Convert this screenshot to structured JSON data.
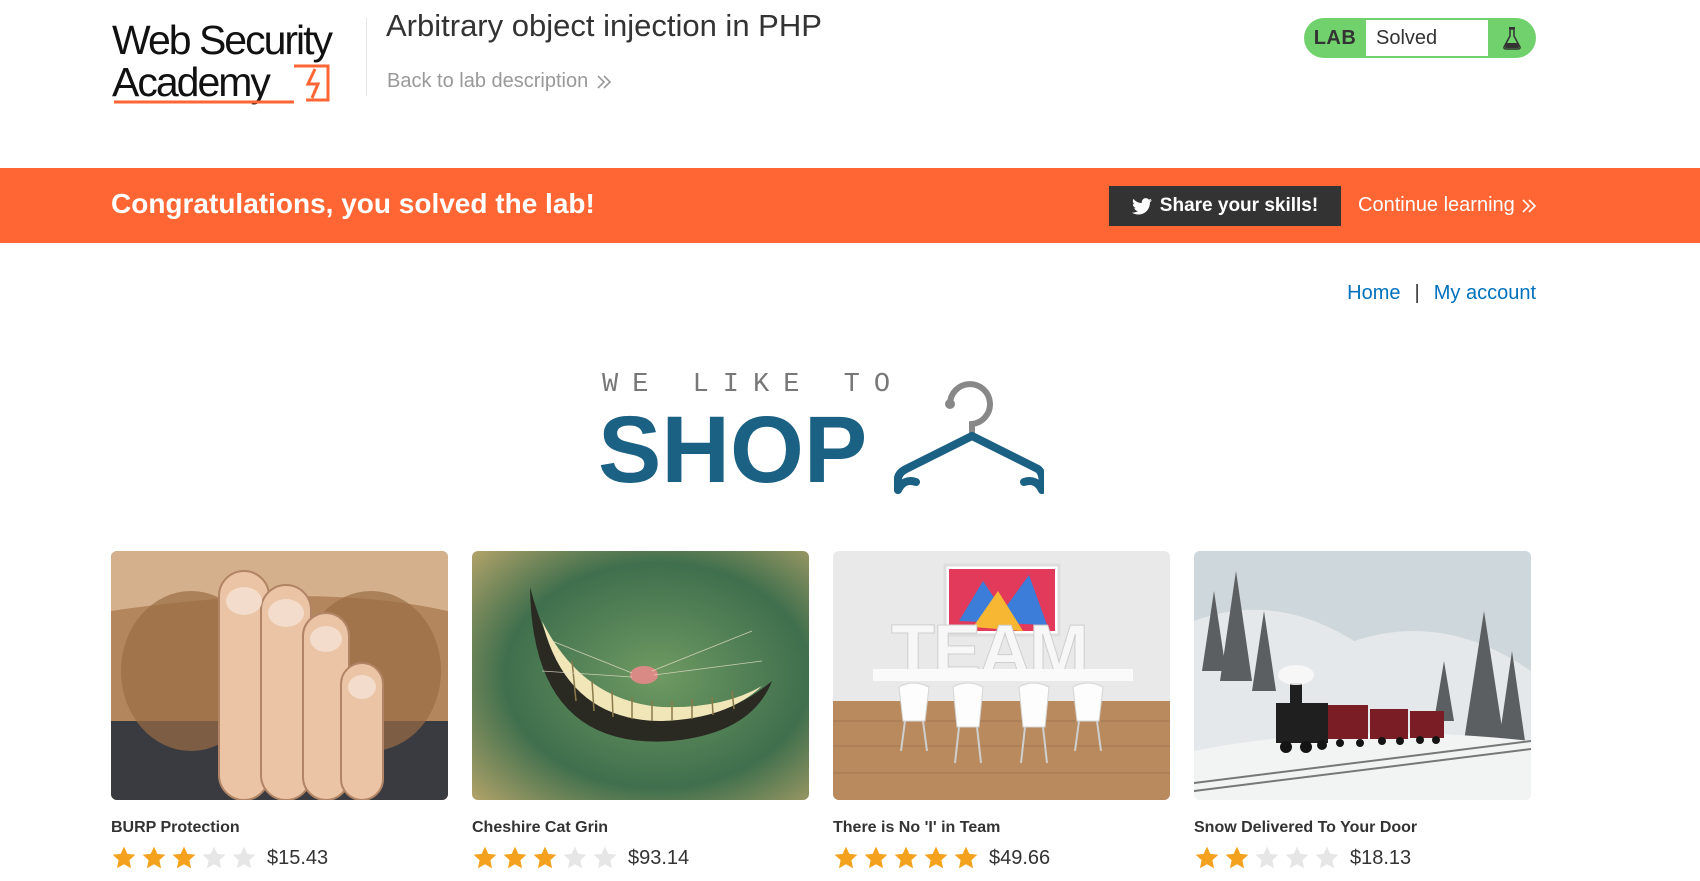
{
  "header": {
    "logo_text_line1": "Web Security",
    "logo_text_line2": "Academy",
    "lab_title": "Arbitrary object injection in PHP",
    "back_link": "Back to lab description",
    "lab_badge": "LAB",
    "lab_status": "Solved"
  },
  "banner": {
    "message": "Congratulations, you solved the lab!",
    "share_label": "Share your skills!",
    "continue_label": "Continue learning"
  },
  "nav": {
    "home": "Home",
    "separator": "|",
    "account": "My account"
  },
  "shop_logo": {
    "tagline": "WE LIKE TO",
    "word": "SHOP"
  },
  "colors": {
    "accent_orange": "#ff6633",
    "lab_green": "#70d16d",
    "link_blue": "#0071bc",
    "shop_blue": "#1b6183",
    "star_gold": "#f4a21d",
    "star_grey": "#e6e6e6"
  },
  "products": [
    {
      "name": "BURP Protection",
      "rating": 3,
      "max_rating": 5,
      "price": "$15.43",
      "image_icon": "bearded-man-hand-over-mouth-image"
    },
    {
      "name": "Cheshire Cat Grin",
      "rating": 3,
      "max_rating": 5,
      "price": "$93.14",
      "image_icon": "cheshire-cat-grin-image"
    },
    {
      "name": "There is No 'I' in Team",
      "rating": 5,
      "max_rating": 5,
      "price": "$49.66",
      "image_icon": "team-letters-meeting-room-image"
    },
    {
      "name": "Snow Delivered To Your Door",
      "rating": 2,
      "max_rating": 5,
      "price": "$18.13",
      "image_icon": "steam-train-snow-image"
    }
  ]
}
